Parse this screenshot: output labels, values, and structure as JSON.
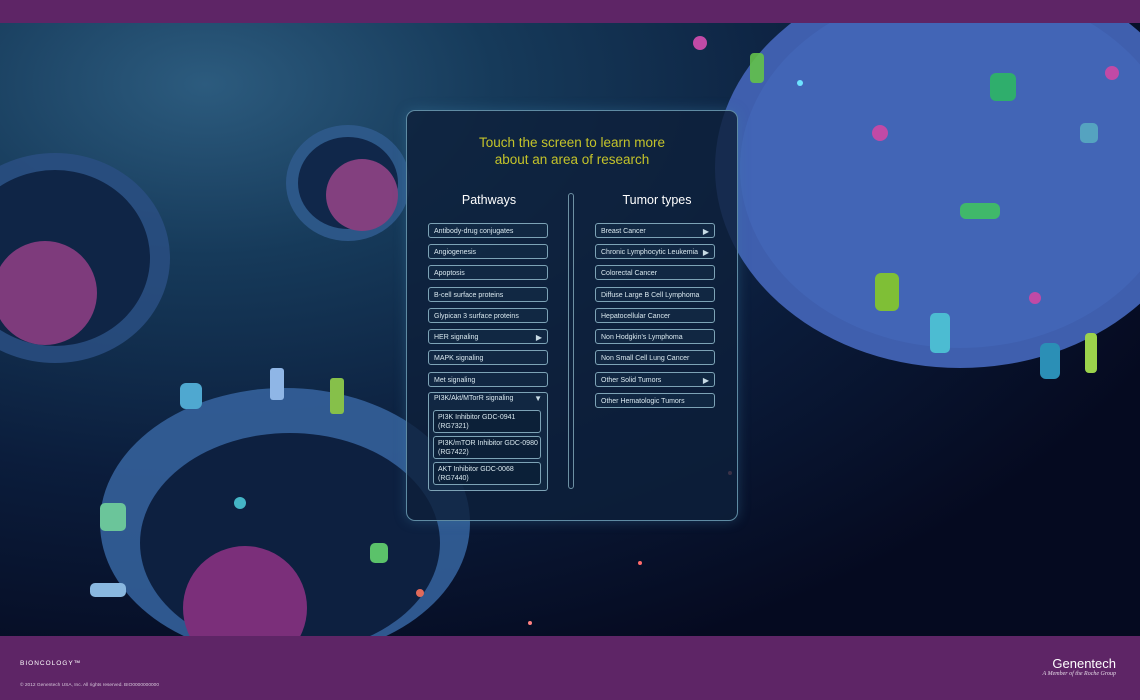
{
  "headline": {
    "line1": "Touch the screen to learn more",
    "line2": "about an area of research"
  },
  "pathways": {
    "title": "Pathways",
    "items": [
      {
        "label": "Antibody-drug conjugates"
      },
      {
        "label": "Angiogenesis"
      },
      {
        "label": "Apoptosis"
      },
      {
        "label": "B-cell surface proteins"
      },
      {
        "label": "Glypican 3 surface proteins"
      },
      {
        "label": "HER signaling",
        "arrow": "▶"
      },
      {
        "label": "MAPK signaling"
      },
      {
        "label": "Met signaling"
      }
    ],
    "expanded": {
      "label": "PI3K/Akt/MTorR signaling",
      "arrow": "▼",
      "subitems": [
        {
          "line1": "PI3K Inhibitor GDC-0941",
          "line2": "(RG7321)"
        },
        {
          "line1": "PI3K/mTOR Inhibitor GDC-0980",
          "line2": "(RG7422)"
        },
        {
          "line1": "AKT Inhibitor GDC-0068",
          "line2": "(RG7440)"
        }
      ]
    }
  },
  "tumor_types": {
    "title": "Tumor types",
    "items": [
      {
        "label": "Breast Cancer",
        "arrow": "▶"
      },
      {
        "label": "Chronic Lymphocytic Leukemia",
        "arrow": "▶"
      },
      {
        "label": "Colorectal Cancer"
      },
      {
        "label": "Diffuse Large B Cell Lymphoma"
      },
      {
        "label": "Hepatocellular Cancer"
      },
      {
        "label": "Non Hodgkin's Lymphoma"
      },
      {
        "label": "Non Small Cell Lung Cancer"
      },
      {
        "label": "Other Solid Tumors",
        "arrow": "▶"
      },
      {
        "label": "Other Hematologic Tumors"
      }
    ]
  },
  "footer": {
    "biooncology": "BIONCOLOGY™",
    "copyright": "© 2012 Genentech USA, Inc. All rights reserved. BIO0000000000",
    "brand": "Genentech",
    "tagline": "A Member of the Roche Group"
  },
  "colors": {
    "bar": "#5e2566",
    "headline": "#c4c32a",
    "panel_border": "#5f8ba3"
  }
}
